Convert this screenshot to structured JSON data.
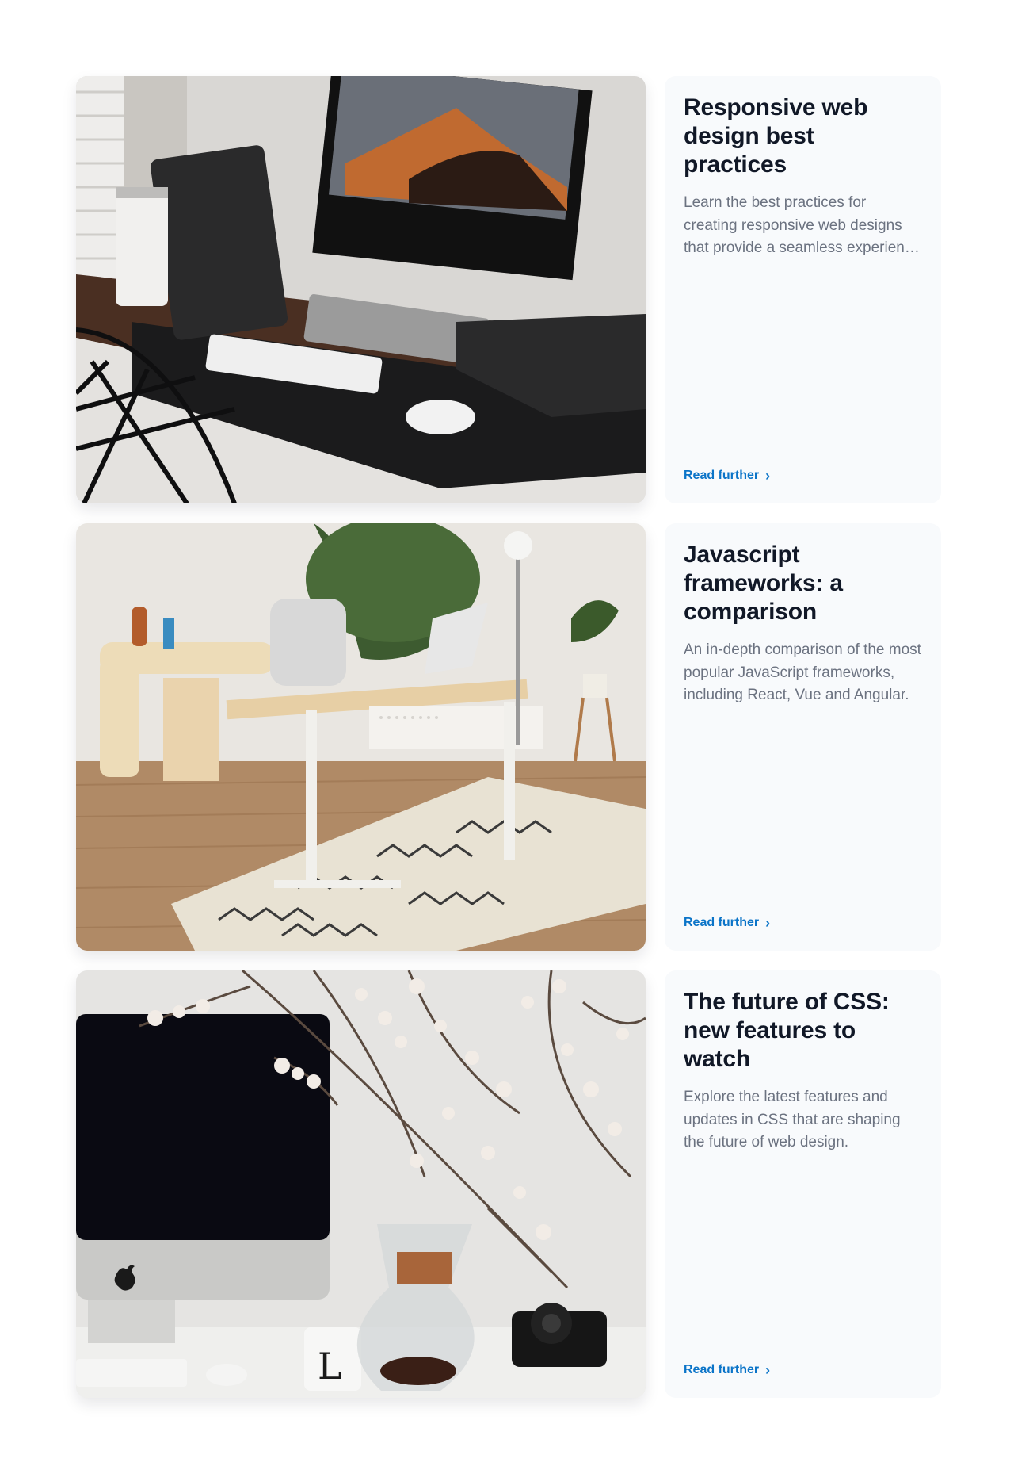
{
  "posts": [
    {
      "title": "Responsive web design best practices",
      "description": "Learn the best practices for creating responsive web designs that provide a seamless experience across devices.",
      "link_label": "Read further",
      "link_icon": "chevron-right-icon",
      "image": "desk-setup-photo"
    },
    {
      "title": "Javascript frameworks: a comparison",
      "description": "An in-depth comparison of the most popular JavaScript frameworks, including React, Vue and Angular.",
      "link_label": "Read further",
      "link_icon": "chevron-right-icon",
      "image": "home-office-photo"
    },
    {
      "title": "The future of CSS: new features to watch",
      "description": "Explore the latest features and updates in CSS that are shaping the future of web design.",
      "link_label": "Read further",
      "link_icon": "chevron-right-icon",
      "image": "imac-blossom-photo"
    }
  ],
  "colors": {
    "accent": "#0b74c8",
    "card_bg": "#f8fafc",
    "title": "#111827",
    "body_text": "#6b7280"
  }
}
